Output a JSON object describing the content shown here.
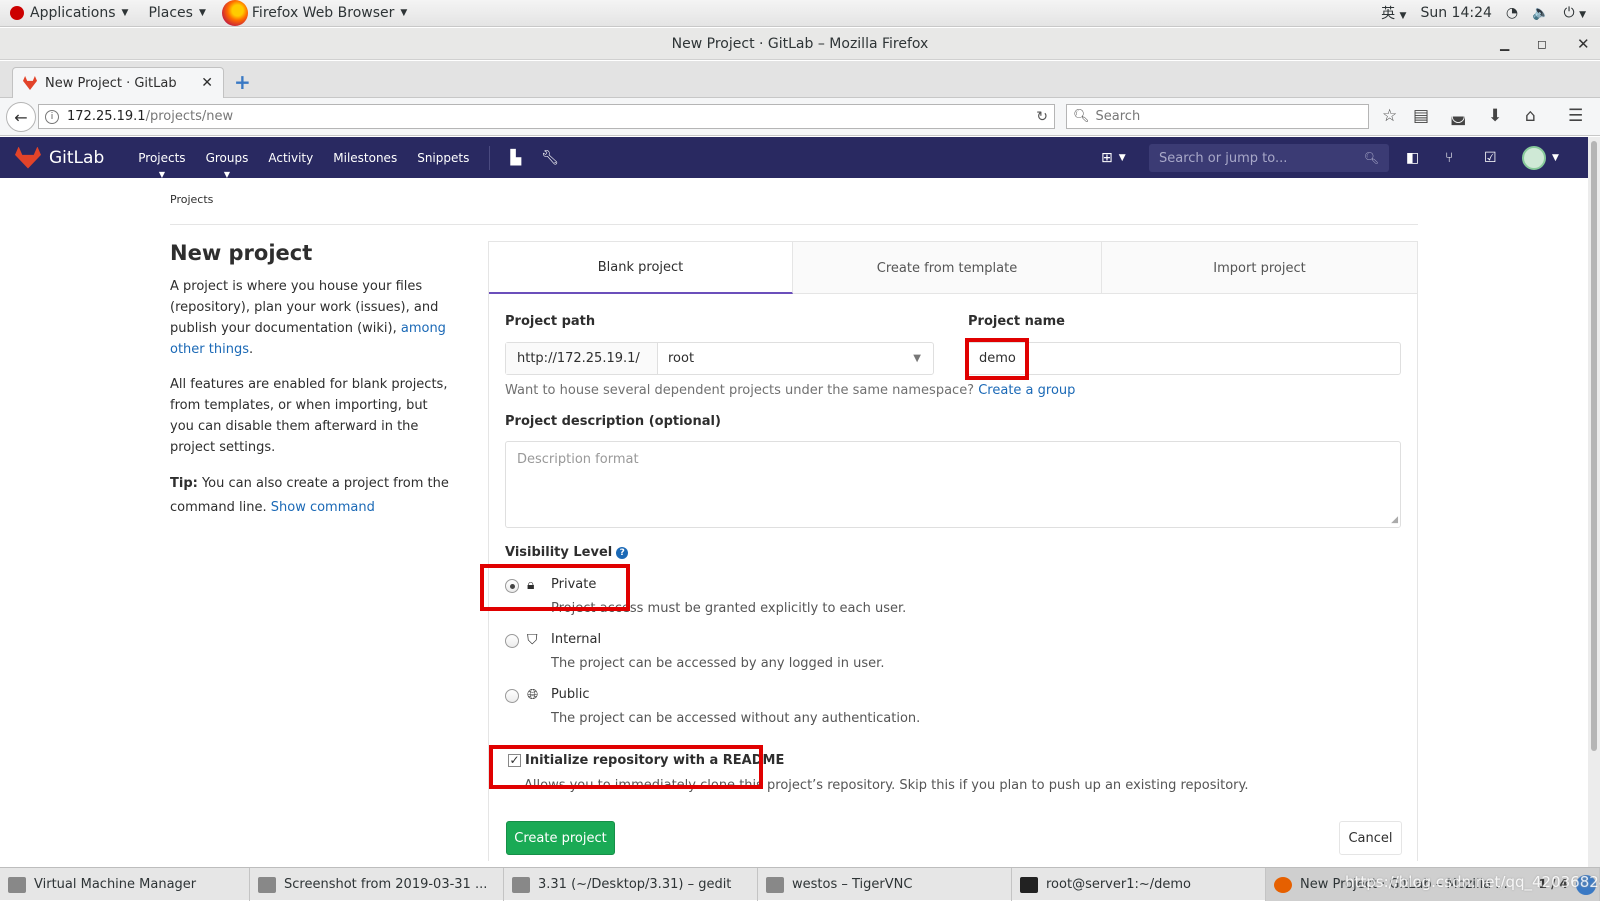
{
  "topbar": {
    "applications": "Applications",
    "places": "Places",
    "active_app": "Firefox Web Browser",
    "input_method": "英",
    "clock": "Sun 14:24"
  },
  "window": {
    "title": "New Project · GitLab – Mozilla Firefox"
  },
  "browser": {
    "tab_title": "New Project · GitLab",
    "url_host": "172.25.19.1",
    "url_path": "/projects/new",
    "search_placeholder": "Search"
  },
  "gitlab": {
    "brand": "GitLab",
    "nav": [
      "Projects",
      "Groups",
      "Activity",
      "Milestones",
      "Snippets"
    ],
    "search_placeholder": "Search or jump to..."
  },
  "page": {
    "breadcrumb": "Projects",
    "title": "New project",
    "intro_1": "A project is where you house your files (repository), plan your work (issues), and publish your documentation (wiki), ",
    "intro_link": "among other things",
    "intro_end": ".",
    "intro_2": "All features are enabled for blank projects, from templates, or when importing, but you can disable them afterward in the project settings.",
    "tip_label": "Tip:",
    "tip_text": " You can also create a project from the command line. ",
    "tip_link": "Show command"
  },
  "tabs": [
    "Blank project",
    "Create from template",
    "Import project"
  ],
  "form": {
    "path_label": "Project path",
    "path_prefix": "http://172.25.19.1/",
    "namespace": "root",
    "name_label": "Project name",
    "name_value": "demo",
    "help_text": "Want to house several dependent projects under the same namespace? ",
    "help_link": "Create a group",
    "desc_label": "Project description (optional)",
    "desc_placeholder": "Description format",
    "visibility_label": "Visibility Level",
    "visibility": [
      {
        "title": "Private",
        "desc": "Project access must be granted explicitly to each user.",
        "icon": "lock-icon",
        "checked": true
      },
      {
        "title": "Internal",
        "desc": "The project can be accessed by any logged in user.",
        "icon": "shield-icon",
        "checked": false
      },
      {
        "title": "Public",
        "desc": "The project can be accessed without any authentication.",
        "icon": "globe-icon",
        "checked": false
      }
    ],
    "readme_label": "Initialize repository with a README",
    "readme_help": "Allows you to immediately clone this project’s repository. Skip this if you plan to push up an existing repository.",
    "create_button": "Create project",
    "cancel_button": "Cancel"
  },
  "taskbar": {
    "items": [
      "Virtual Machine Manager",
      "Screenshot from 2019-03-31 ...",
      "3.31 (~/Desktop/3.31) – gedit",
      "westos – TigerVNC",
      "root@server1:~/demo",
      "New Project · GitLab – Mozilla ..."
    ],
    "pager": "1 / 4",
    "watermark": "https://blog.csdn.net/qq_42036824"
  },
  "colors": {
    "gitlab_header": "#292961",
    "create_button": "#1aaa55",
    "link": "#1b69b6",
    "highlight_box": "#e00000",
    "active_tab_underline": "#6b4fbb"
  }
}
